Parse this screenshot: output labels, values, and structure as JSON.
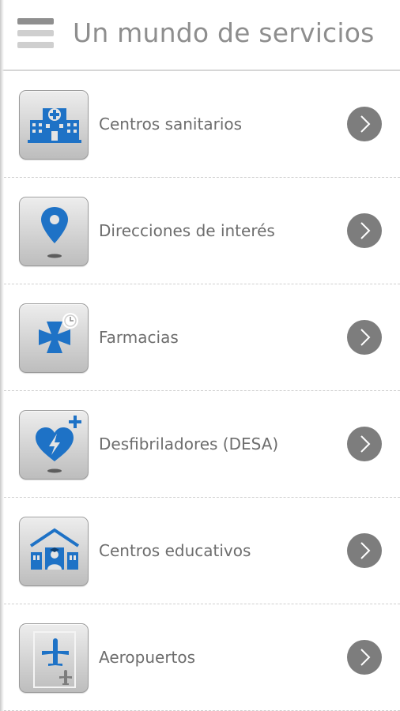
{
  "header": {
    "title": "Un mundo de servicios",
    "menu_icon": "hamburger-menu-icon"
  },
  "services": [
    {
      "label": "Centros sanitarios",
      "icon": "hospital-icon"
    },
    {
      "label": "Direcciones de interés",
      "icon": "map-pin-icon"
    },
    {
      "label": "Farmacias",
      "icon": "pharmacy-cross-icon"
    },
    {
      "label": "Desfibriladores (DESA)",
      "icon": "defibrillator-heart-icon"
    },
    {
      "label": "Centros educativos",
      "icon": "school-icon"
    },
    {
      "label": "Aeropuertos",
      "icon": "airport-icon"
    }
  ],
  "colors": {
    "accent": "#1e72c6",
    "title": "#8e8e8e",
    "label": "#6d6d6d",
    "chevron_bg": "#7d7d7d"
  }
}
